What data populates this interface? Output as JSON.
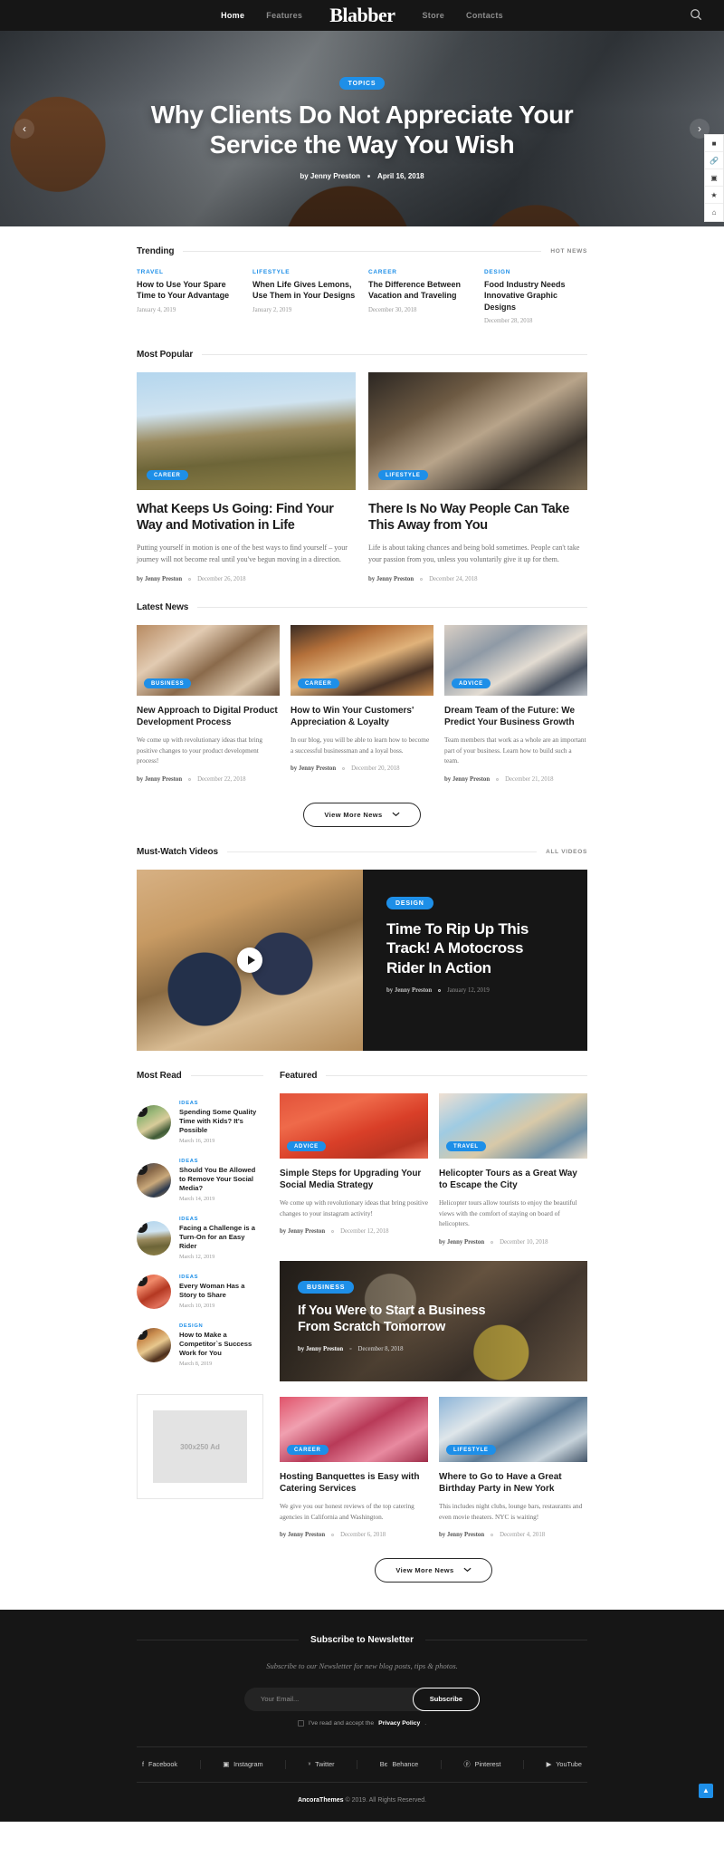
{
  "nav": {
    "logo": "Blabber",
    "items": [
      {
        "label": "Home",
        "active": true
      },
      {
        "label": "Features",
        "active": false
      },
      {
        "label": "Store",
        "active": false
      },
      {
        "label": "Contacts",
        "active": false
      }
    ],
    "search_icon": "search-icon"
  },
  "hero": {
    "badge": "TOPICS",
    "title": "Why Clients Do Not Appreciate Your Service the Way You Wish",
    "author": "by Jenny Preston",
    "date": "April 16, 2018",
    "prev_icon": "chevron-left-icon",
    "next_icon": "chevron-right-icon",
    "side_tools": [
      "grid-icon",
      "link-icon",
      "image-icon",
      "star-icon",
      "home-icon"
    ]
  },
  "trending": {
    "title": "Trending",
    "more_label": "HOT NEWS",
    "items": [
      {
        "category": "TRAVEL",
        "title": "How to Use Your Spare Time to Your Advantage",
        "date": "January 4, 2019"
      },
      {
        "category": "LIFESTYLE",
        "title": "When Life Gives Lemons, Use Them in Your Designs",
        "date": "January 2, 2019"
      },
      {
        "category": "CAREER",
        "title": "The Difference Between Vacation and Traveling",
        "date": "December 30, 2018"
      },
      {
        "category": "DESIGN",
        "title": "Food Industry Needs Innovative Graphic Designs",
        "date": "December 28, 2018"
      }
    ]
  },
  "most_popular": {
    "title": "Most Popular",
    "items": [
      {
        "badge": "CAREER",
        "title": "What Keeps Us Going: Find Your Way and Motivation in Life",
        "excerpt": "Putting yourself in motion is one of the best ways to find yourself – your journey will not become real until you've begun moving in a direction.",
        "author": "by Jenny Preston",
        "date": "December 26, 2018"
      },
      {
        "badge": "LIFESTYLE",
        "title": "There Is No Way People Can Take This Away from You",
        "excerpt": "Life is about taking chances and being bold sometimes. People can't take your passion from you, unless you voluntarily give it up for them.",
        "author": "by Jenny Preston",
        "date": "December 24, 2018"
      }
    ]
  },
  "latest_news": {
    "title": "Latest News",
    "items": [
      {
        "badge": "BUSINESS",
        "title": "New Approach to Digital Product Development Process",
        "excerpt": "We come up with revolutionary ideas that bring positive changes to your product development process!",
        "author": "by Jenny Preston",
        "date": "December 22, 2018"
      },
      {
        "badge": "CAREER",
        "title": "How to Win Your Customers' Appreciation & Loyalty",
        "excerpt": "In our blog, you will be able to learn how to become a successful businessman and a loyal boss.",
        "author": "by Jenny Preston",
        "date": "December 20, 2018"
      },
      {
        "badge": "ADVICE",
        "title": "Dream Team of the Future: We Predict Your Business Growth",
        "excerpt": "Team members that work as a whole are an important part of your business. Learn how to build such a team.",
        "author": "by Jenny Preston",
        "date": "December 21, 2018"
      }
    ],
    "view_more": "View More News",
    "view_more_icon": "chevron-down-icon"
  },
  "videos": {
    "title": "Must-Watch Videos",
    "more_label": "ALL VIDEOS",
    "play_icon": "play-icon",
    "featured": {
      "badge": "DESIGN",
      "title": "Time To Rip Up This Track! A Motocross Rider In Action",
      "author": "by Jenny Preston",
      "date": "January 12, 2019"
    }
  },
  "most_read": {
    "title": "Most Read",
    "items": [
      {
        "rank": "1",
        "category": "IDEAS",
        "title": "Spending Some Quality Time with Kids? It's Possible",
        "date": "March 16, 2019"
      },
      {
        "rank": "2",
        "category": "IDEAS",
        "title": "Should You Be Allowed to Remove Your Social Media?",
        "date": "March 14, 2019"
      },
      {
        "rank": "3",
        "category": "IDEAS",
        "title": "Facing a Challenge is a Turn-On for an Easy Rider",
        "date": "March 12, 2019"
      },
      {
        "rank": "4",
        "category": "IDEAS",
        "title": "Every Woman Has a Story to Share",
        "date": "March 10, 2019"
      },
      {
        "rank": "5",
        "category": "DESIGN",
        "title": "How to Make a Competitor`s Success Work for You",
        "date": "March 8, 2019"
      }
    ],
    "ad_label": "300x250 Ad"
  },
  "featured": {
    "title": "Featured",
    "top_row": [
      {
        "badge": "ADVICE",
        "title": "Simple Steps for Upgrading Your Social Media Strategy",
        "excerpt": "We come up with revolutionary ideas that bring positive changes to your instagram activity!",
        "author": "by Jenny Preston",
        "date": "December 12, 2018"
      },
      {
        "badge": "TRAVEL",
        "title": "Helicopter Tours as a Great Way to Escape the City",
        "excerpt": "Helicopter tours allow tourists to enjoy the beautiful views with the comfort of staying on board of helicopters.",
        "author": "by Jenny Preston",
        "date": "December 10, 2018"
      }
    ],
    "wide": {
      "badge": "BUSINESS",
      "title": "If You Were to Start a Business From Scratch Tomorrow",
      "author": "by Jenny Preston",
      "date": "December 8, 2018"
    },
    "bottom_row": [
      {
        "badge": "CAREER",
        "title": "Hosting Banquettes is Easy with Catering Services",
        "excerpt": "We give you our honest reviews of the top catering agencies in California and Washington.",
        "author": "by Jenny Preston",
        "date": "December 6, 2018"
      },
      {
        "badge": "LIFESTYLE",
        "title": "Where to Go to Have a Great Birthday Party in New York",
        "excerpt": "This includes night clubs, lounge bars, restaurants and even movie theaters. NYC is waiting!",
        "author": "by Jenny Preston",
        "date": "December 4, 2018"
      }
    ],
    "view_more": "View More News",
    "view_more_icon": "chevron-down-icon"
  },
  "footer": {
    "newsletter_title": "Subscribe to Newsletter",
    "newsletter_sub": "Subscribe to our Newsletter for new blog posts, tips & photos.",
    "email_placeholder": "Your Email...",
    "email_value": "",
    "subscribe_label": "Subscribe",
    "consent_pre": "I've read and accept the ",
    "consent_link": "Privacy Policy",
    "consent_post": ".",
    "social": [
      {
        "icon": "facebook-icon",
        "glyph": "f",
        "label": "Facebook"
      },
      {
        "icon": "instagram-icon",
        "glyph": "▣",
        "label": "Instagram"
      },
      {
        "icon": "twitter-icon",
        "glyph": "ᵛ",
        "label": "Twitter"
      },
      {
        "icon": "behance-icon",
        "glyph": "Bє",
        "label": "Behance"
      },
      {
        "icon": "pinterest-icon",
        "glyph": "ⓟ",
        "label": "Pinterest"
      },
      {
        "icon": "youtube-icon",
        "glyph": "▶",
        "label": "YouTube"
      }
    ],
    "copyright_brand": "AncoraThemes",
    "copyright_rest": " © 2019. All Rights Reserved.",
    "to_top_icon": "chevron-up-icon"
  },
  "colors": {
    "accent": "#1e8fe8",
    "dark": "#161616",
    "muted": "#9b9b9b"
  }
}
